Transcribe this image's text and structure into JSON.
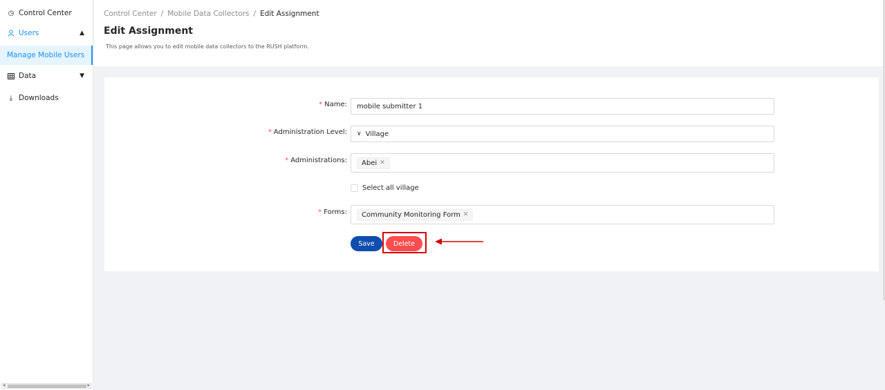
{
  "sidebar": {
    "items": [
      {
        "label": "Control Center",
        "icon": "dashboard-icon"
      },
      {
        "label": "Users",
        "icon": "user-icon"
      },
      {
        "label": "Manage Mobile Users"
      },
      {
        "label": "Data",
        "icon": "table-icon"
      },
      {
        "label": "Downloads",
        "icon": "download-icon"
      }
    ]
  },
  "breadcrumb": {
    "items": [
      "Control Center",
      "Mobile Data Collectors",
      "Edit Assignment"
    ],
    "separator": "/"
  },
  "page": {
    "title": "Edit Assignment",
    "description": "This page allows you to edit mobile data collectors to the RUSH platform."
  },
  "form": {
    "name_label": "Name",
    "name_value": "mobile submitter 1",
    "admin_level_label": "Administration Level",
    "admin_level_value": "Village",
    "administrations_label": "Administrations",
    "administrations_tags": [
      "Abei"
    ],
    "select_all_label": "Select all village",
    "forms_label": "Forms",
    "forms_tags": [
      "Community Monitoring Form"
    ],
    "required_mark": "*",
    "colon": ":"
  },
  "buttons": {
    "save_label": "Save",
    "delete_label": "Delete"
  },
  "colors": {
    "primary": "#0f4ead",
    "danger": "#ff4d4f",
    "accent": "#1890ff",
    "highlight": "#d40000"
  }
}
